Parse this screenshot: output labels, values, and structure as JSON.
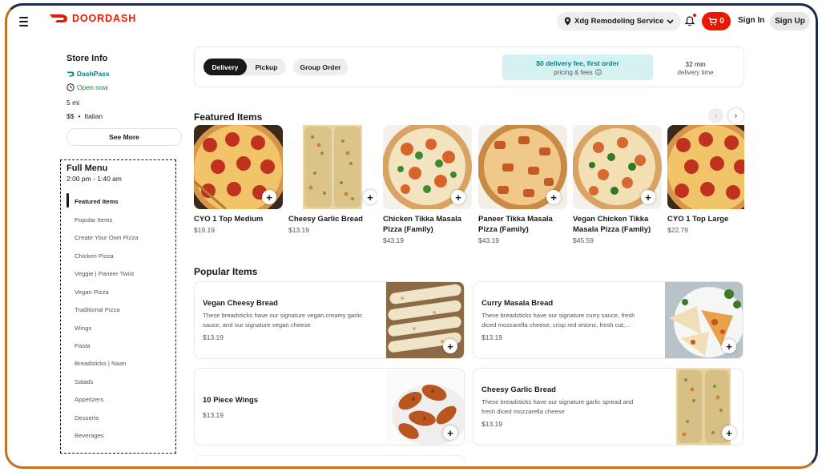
{
  "header": {
    "brand": "DOORDASH",
    "address": "Xdg Remodeling Service",
    "cart_count": "0",
    "sign_in": "Sign In",
    "sign_up": "Sign Up",
    "brand_color": "#eb1700"
  },
  "store": {
    "title": "Store Info",
    "dashpass": "DashPass",
    "status": "Open now",
    "distance": "5 mi",
    "price": "$$",
    "dot": "•",
    "cuisine": "Italian",
    "see_more": "See More"
  },
  "menu": {
    "title": "Full Menu",
    "hours": "2:00 pm - 1:40 am",
    "items": [
      "Featured Items",
      "Popular Items",
      "Create Your Own Pizza",
      "Chicken Pizza",
      "Veggie | Paneer Twist",
      "Vegan Pizza",
      "Traditional Pizza",
      "Wings",
      "Pasta",
      "Breadsticks | Naan",
      "Salads",
      "Appetizers",
      "Desserts",
      "Beverages"
    ]
  },
  "order_bar": {
    "delivery": "Delivery",
    "pickup": "Pickup",
    "group_order": "Group Order",
    "promo_title": "$0 delivery fee, first order",
    "promo_sub": "pricing & fees",
    "eta": "32 min",
    "eta_label": "delivery time"
  },
  "featured": {
    "title": "Featured Items",
    "items": [
      {
        "name": "CYO 1 Top Medium",
        "price": "$19.19"
      },
      {
        "name": "Cheesy Garlic Bread",
        "price": "$13.19"
      },
      {
        "name": "Chicken Tikka Masala Pizza (Family)",
        "price": "$43.19"
      },
      {
        "name": "Paneer Tikka Masala Pizza (Family)",
        "price": "$43.19"
      },
      {
        "name": "Vegan Chicken Tikka Masala Pizza (Family)",
        "price": "$45.59"
      },
      {
        "name": "CYO 1 Top Large",
        "price": "$22.79"
      }
    ]
  },
  "popular": {
    "title": "Popular Items",
    "items": [
      {
        "name": "Vegan Cheesy Bread",
        "desc": "These breadsticks have our signature vegan creamy garlic sauce, and our signature vegan cheese",
        "price": "$13.19"
      },
      {
        "name": "Curry Masala Bread",
        "desc": "These breadsticks have our signature curry sauce, fresh diced mozzarella cheese, crisp red onions, fresh cut;...",
        "price": "$13.19"
      },
      {
        "name": "10 Piece Wings",
        "desc": "",
        "price": "$13.19"
      },
      {
        "name": "Cheesy Garlic Bread",
        "desc": "These breadsticks have our signature garlic spread and fresh diced mozzarella cheese",
        "price": "$13.19"
      }
    ]
  }
}
